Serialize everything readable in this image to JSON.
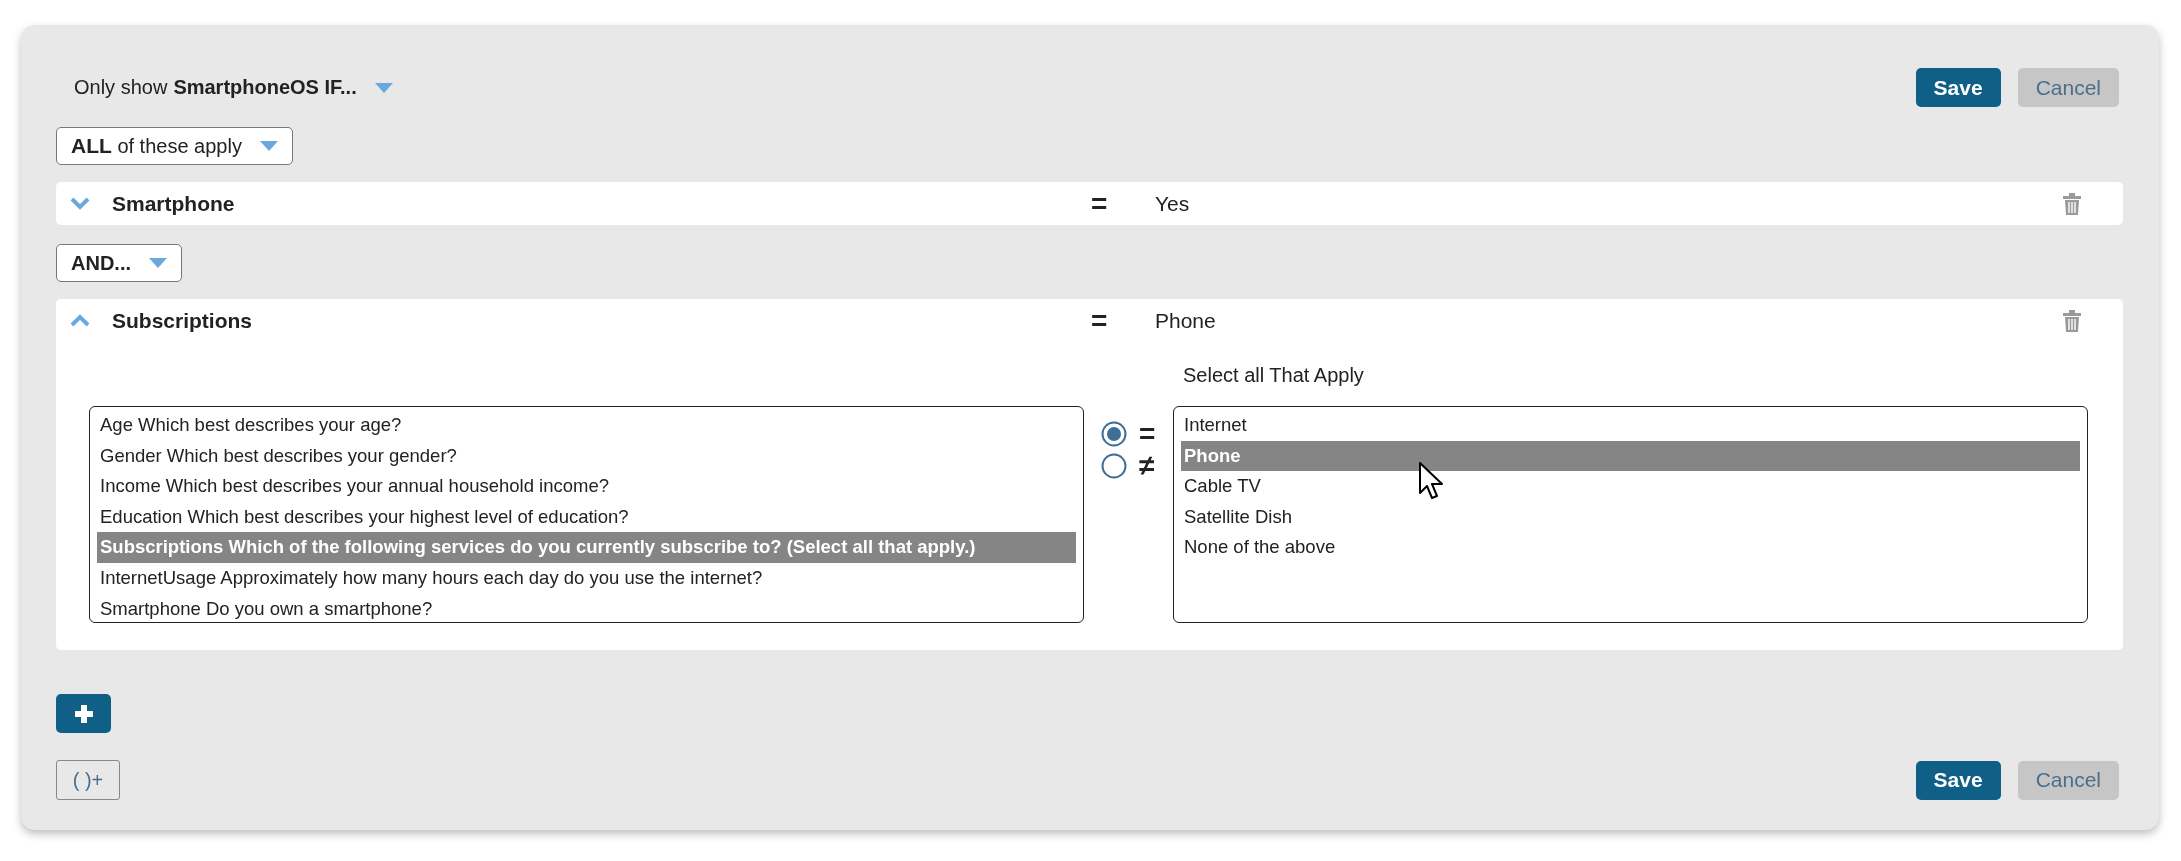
{
  "header": {
    "prefix": "Only show",
    "target": "SmartphoneOS IF..."
  },
  "top_buttons": [
    {
      "label": "Save",
      "kind": "primary"
    },
    {
      "label": "Cancel",
      "kind": "secondary"
    }
  ],
  "match_select": {
    "value": "**ALL** of these apply"
  },
  "conditions": [
    {
      "question": "Smartphone",
      "operator": "=",
      "answer": "Yes",
      "expanded": false
    },
    {
      "connector": "AND...",
      "question": "Subscriptions",
      "operator": "=",
      "answer": "Phone",
      "expanded": true,
      "editor": {
        "label": "Select all That Apply",
        "questions": [
          {
            "text": "Age Which best describes your age?",
            "selected": false
          },
          {
            "text": "Gender Which best describes your gender?",
            "selected": false
          },
          {
            "text": "Income Which best describes your annual household income?",
            "selected": false
          },
          {
            "text": "Education Which best describes your highest level of education?",
            "selected": false
          },
          {
            "text": "Subscriptions Which of the following services do you currently subscribe to? (Select all that apply.)",
            "selected": true
          },
          {
            "text": "InternetUsage Approximately how many hours each day do you use the internet?",
            "selected": false
          },
          {
            "text": "Smartphone Do you own a smartphone?",
            "selected": false
          }
        ],
        "operators": [
          {
            "symbol": "=",
            "selected": true
          },
          {
            "symbol": "≠",
            "selected": false
          }
        ],
        "options": [
          {
            "text": "Internet",
            "selected": false
          },
          {
            "text": "Phone",
            "selected": true
          },
          {
            "text": "Cable TV",
            "selected": false
          },
          {
            "text": "Satellite Dish",
            "selected": false
          },
          {
            "text": "None of the above",
            "selected": false
          }
        ]
      }
    }
  ],
  "group_button": {
    "label": "( )+"
  },
  "bottom_buttons": [
    {
      "label": "Save",
      "kind": "primary"
    },
    {
      "label": "Cancel",
      "kind": "secondary"
    }
  ]
}
